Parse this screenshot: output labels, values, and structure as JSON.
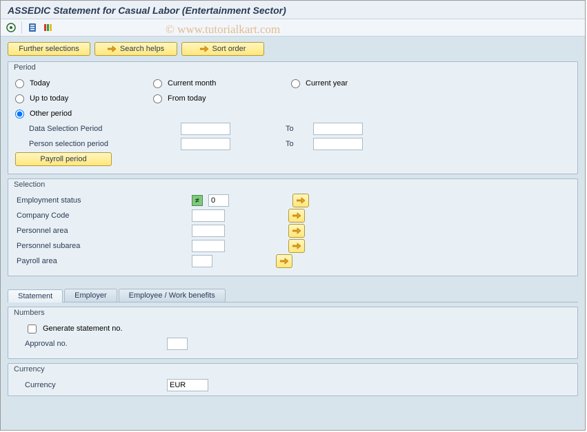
{
  "title": "ASSEDIC Statement for Casual Labor (Entertainment Sector)",
  "watermark": "© www.tutorialkart.com",
  "toolbar_buttons": {
    "further_selections": "Further selections",
    "search_helps": "Search helps",
    "sort_order": "Sort order"
  },
  "period": {
    "legend": "Period",
    "radios": {
      "today": "Today",
      "current_month": "Current month",
      "current_year": "Current year",
      "up_to_today": "Up to today",
      "from_today": "From today",
      "other_period": "Other period"
    },
    "selected": "other_period",
    "data_selection_label": "Data Selection Period",
    "person_selection_label": "Person selection period",
    "to_label": "To",
    "data_from": "",
    "data_to": "",
    "person_from": "",
    "person_to": "",
    "payroll_period_button": "Payroll period"
  },
  "selection": {
    "legend": "Selection",
    "rows": {
      "employment_status": {
        "label": "Employment status",
        "value": "0",
        "special": true
      },
      "company_code": {
        "label": "Company Code",
        "value": ""
      },
      "personnel_area": {
        "label": "Personnel area",
        "value": ""
      },
      "personnel_subarea": {
        "label": "Personnel subarea",
        "value": ""
      },
      "payroll_area": {
        "label": "Payroll area",
        "value": ""
      }
    }
  },
  "tabs": {
    "statement": "Statement",
    "employer": "Employer",
    "employee_benefits": "Employee / Work benefits",
    "active": "statement"
  },
  "numbers": {
    "legend": "Numbers",
    "generate_label": "Generate statement no.",
    "generate_checked": false,
    "approval_label": "Approval no.",
    "approval_value": ""
  },
  "currency": {
    "legend": "Currency",
    "label": "Currency",
    "value": "EUR"
  }
}
